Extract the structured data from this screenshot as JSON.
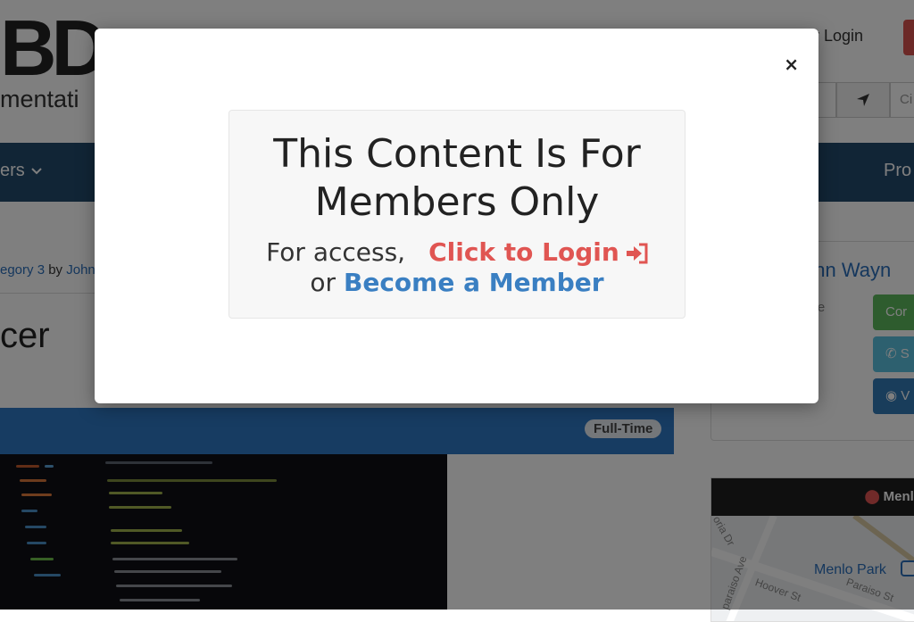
{
  "background": {
    "logo_text": "BD",
    "logo_sub": "mentati",
    "top_login": "er Login",
    "search_partial": "Ci",
    "nav_left": "ers",
    "nav_right": "Pro",
    "breadcrumb_category": "egory 3",
    "breadcrumb_by": " by ",
    "breadcrumb_author": "John",
    "page_title": "cer",
    "job_badge": "Full-Time",
    "agent_name": "ohn Wayn",
    "agent_sub": "yne",
    "sidebar_btn_1": "Cor",
    "sidebar_btn_2": "S",
    "sidebar_btn_3": "V",
    "map_title": "Menlo",
    "map_place": "Menlo Park",
    "map_street_1": "oria Dr",
    "map_street_2": "paraiso Ave",
    "map_street_3": "Hoover St",
    "map_street_4": "Paraiso St",
    "colors": {
      "navbar": "#234a6c",
      "job_bar": "#2f78c4",
      "login_red": "#e05552",
      "member_blue": "#3a7fc2"
    }
  },
  "modal": {
    "close_label": "×",
    "title": "This Content Is For Members Only",
    "access_prefix": "For access,",
    "login_label": "Click to Login",
    "login_icon": "sign-in-icon",
    "or_text": "or",
    "member_label": "Become a Member"
  }
}
